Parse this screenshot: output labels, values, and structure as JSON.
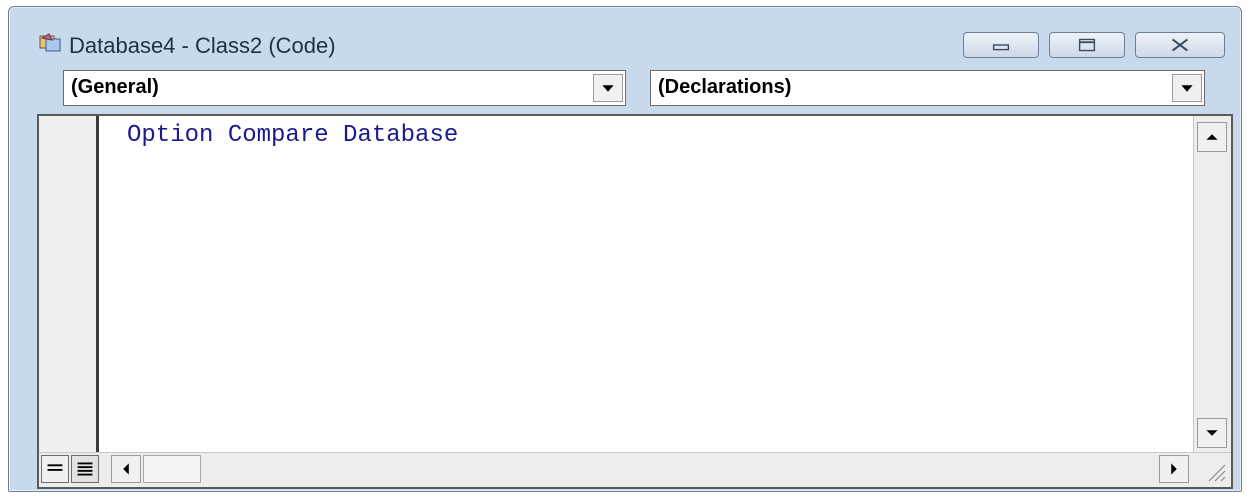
{
  "window": {
    "title": "Database4 - Class2 (Code)",
    "app_icon": "vba-project-icon",
    "controls": [
      "minimize-icon",
      "maximize-icon",
      "close-icon"
    ]
  },
  "object_combo": {
    "selected": "(General)",
    "icon": "chevron-down-icon"
  },
  "procedure_combo": {
    "selected": "(Declarations)",
    "icon": "chevron-down-icon"
  },
  "editor": {
    "lines": [
      "Option Compare Database"
    ],
    "keyword_color": "#1a1a8c"
  },
  "view_buttons": {
    "procedure_view_icon": "procedure-view-icon",
    "full_module_view_icon": "full-module-view-icon"
  },
  "colors": {
    "frame": "#c8d9ec",
    "border": "#6d7f96"
  }
}
